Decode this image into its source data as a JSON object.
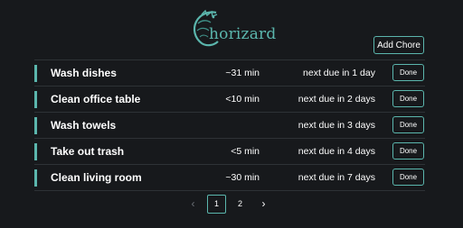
{
  "app": {
    "logo_text": "horizard"
  },
  "toolbar": {
    "add_chore_label": "Add Chore"
  },
  "chores": [
    {
      "name": "Wash dishes",
      "duration": "~31 min",
      "due": "next due in 1 day",
      "done_label": "Done"
    },
    {
      "name": "Clean office table",
      "duration": "<10 min",
      "due": "next due in 2 days",
      "done_label": "Done"
    },
    {
      "name": "Wash towels",
      "duration": "",
      "due": "next due in 3 days",
      "done_label": "Done"
    },
    {
      "name": "Take out trash",
      "duration": "<5 min",
      "due": "next due in 4 days",
      "done_label": "Done"
    },
    {
      "name": "Clean living room",
      "duration": "~30 min",
      "due": "next due in 7 days",
      "done_label": "Done"
    }
  ],
  "pagination": {
    "prev_icon": "‹",
    "pages": [
      "1",
      "2"
    ],
    "current_page": "1",
    "next_icon": "›"
  },
  "colors": {
    "background": "#17191c",
    "accent": "#5bb6ad",
    "divider": "#2e3236"
  }
}
